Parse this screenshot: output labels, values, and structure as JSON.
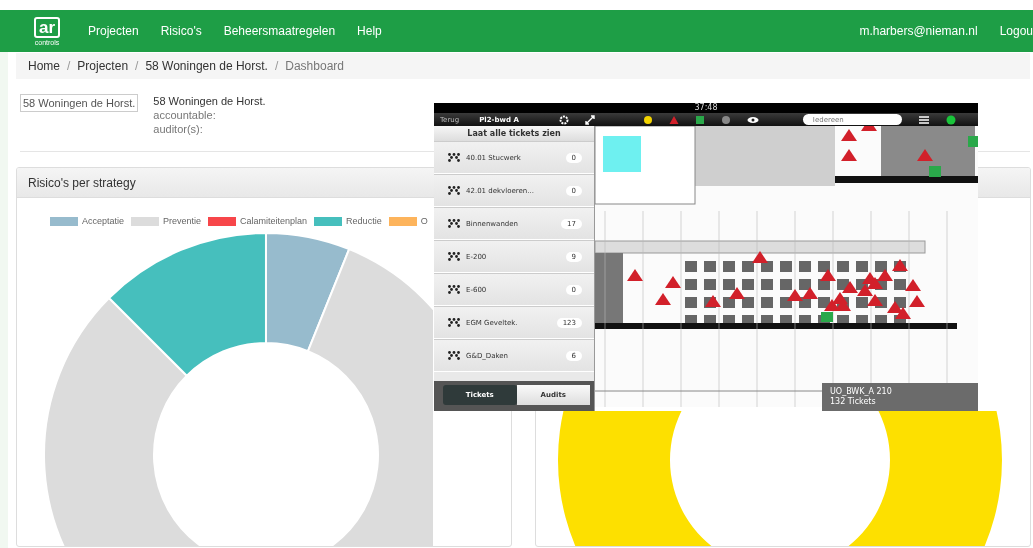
{
  "nav": {
    "logo": "ar",
    "logo_caption": "controls",
    "items": [
      "Projecten",
      "Risico's",
      "Beheersmaatregelen",
      "Help"
    ],
    "user": "m.harbers@nieman.nl",
    "logout": "Logou"
  },
  "breadcrumb": [
    {
      "label": "Home",
      "selected": false
    },
    {
      "label": "Projecten",
      "selected": false
    },
    {
      "label": "58 Woningen de Horst.",
      "selected": false
    },
    {
      "label": "Dashboard",
      "selected": true
    }
  ],
  "project": {
    "image_alt": "58 Woningen de Horst.",
    "name": "58 Woningen de Horst.",
    "accountable": "accountable:",
    "auditors": "auditor(s):"
  },
  "breadcrumb_separator": "/",
  "panels": [
    {
      "kind": "donut",
      "title": "Risico's per strategy",
      "legend": [
        {
          "label": "Acceptatie",
          "color": "#97bbcd"
        },
        {
          "label": "Preventie",
          "color": "#dcdcdc"
        },
        {
          "label": "Calamiteitenplan",
          "color": "#f7464a"
        },
        {
          "label": "Reductie",
          "color": "#46bfbd"
        },
        {
          "label": "O",
          "color": "#fdb45c"
        }
      ]
    },
    {
      "kind": "ring"
    }
  ],
  "tablet": {
    "time": "37:48",
    "back": "Terug",
    "title": "Pl2-bwd A",
    "search": "Iedereen",
    "list_header": "Laat alle tickets zien",
    "items": [
      {
        "name": "40.01 Stucwerk",
        "count": "0"
      },
      {
        "name": "42.01 dekvloeren...",
        "count": "0"
      },
      {
        "name": "Binnenwanden",
        "count": "17"
      },
      {
        "name": "E-200",
        "count": "9"
      },
      {
        "name": "E-600",
        "count": "0"
      },
      {
        "name": "EGM Geveltek.",
        "count": "123"
      },
      {
        "name": "G&D_Daken",
        "count": "6"
      }
    ],
    "tabs": [
      {
        "label": "Tickets",
        "selected": true
      },
      {
        "label": "Audits",
        "selected": false
      }
    ],
    "sheet_name": "UO_BWK_A 210",
    "sheet_tickets": "132 Tickets"
  }
}
